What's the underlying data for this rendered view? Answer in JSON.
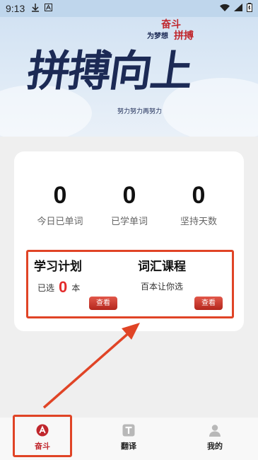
{
  "status_bar": {
    "time": "9:13",
    "icons": [
      "download-icon",
      "app-icon"
    ],
    "right_icons": [
      "wifi-icon",
      "signal-icon",
      "battery-icon"
    ]
  },
  "banner": {
    "title": "拼搏向上",
    "sub_red_1": "奋斗",
    "sub_blue": "为梦想",
    "sub_red_2": "拼搏",
    "caption": "努力努力再努力"
  },
  "stats": [
    {
      "value": "0",
      "label": "今日已单词"
    },
    {
      "value": "0",
      "label": "已学单词"
    },
    {
      "value": "0",
      "label": "坚持天数"
    }
  ],
  "study_plan": {
    "title": "学习计划",
    "prefix": "已选",
    "count": "0",
    "suffix": "本",
    "button": "查看"
  },
  "vocab_course": {
    "title": "词汇课程",
    "desc": "百本让你选",
    "button": "查看"
  },
  "bottom_nav": [
    {
      "label": "奋斗",
      "icon": "a-circle-icon",
      "active": true
    },
    {
      "label": "翻译",
      "icon": "translate-icon",
      "active": false
    },
    {
      "label": "我的",
      "icon": "user-icon",
      "active": false
    }
  ],
  "colors": {
    "accent_red": "#c0272d",
    "highlight": "#e04426",
    "status_bar": "#bfd6ec"
  }
}
